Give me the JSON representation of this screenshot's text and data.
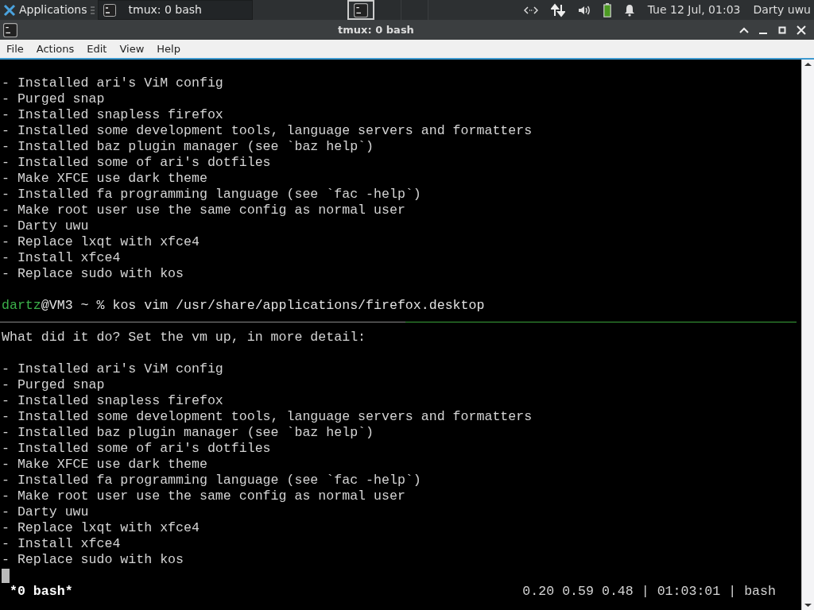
{
  "panel": {
    "app_menu": "Applications",
    "tasks": [
      {
        "title": "tmux: 0 bash",
        "selected": false
      }
    ],
    "workspaces": [
      {
        "selected": true
      },
      {
        "selected": false
      },
      {
        "selected": false
      }
    ],
    "clock": "Tue 12 Jul, 01:03",
    "user": "Darty uwu"
  },
  "window": {
    "title": "tmux: 0 bash"
  },
  "menu": [
    "File",
    "Actions",
    "Edit",
    "View",
    "Help"
  ],
  "top_pane": {
    "lines": [
      "- Installed ari's ViM config",
      "- Purged snap",
      "- Installed snapless firefox",
      "- Installed some development tools, language servers and formatters",
      "- Installed baz plugin manager (see `baz help`)",
      "- Installed some of ari's dotfiles",
      "- Make XFCE use dark theme",
      "- Installed fa programming language (see `fac -help`)",
      "- Make root user use the same config as normal user",
      "- Darty uwu",
      "- Replace lxqt with xfce4",
      "- Install xfce4",
      "- Replace sudo with kos"
    ],
    "prompt": {
      "user": "dartz",
      "host": "@VM3 ~ % ",
      "command": "kos vim /usr/share/applications/firefox.desktop"
    }
  },
  "bottom_pane": {
    "heading": "What did it do? Set the vm up, in more detail:",
    "lines": [
      "- Installed ari's ViM config",
      "- Purged snap",
      "- Installed snapless firefox",
      "- Installed some development tools, language servers and formatters",
      "- Installed baz plugin manager (see `baz help`)",
      "- Installed some of ari's dotfiles",
      "- Make XFCE use dark theme",
      "- Installed fa programming language (see `fac -help`)",
      "- Make root user use the same config as normal user",
      "- Darty uwu",
      "- Replace lxqt with xfce4",
      "- Install xfce4",
      "- Replace sudo with kos"
    ]
  },
  "status_bar": {
    "window": "*0 bash*",
    "info": "0.20 0.59 0.48 | 01:03:01 | bash"
  }
}
